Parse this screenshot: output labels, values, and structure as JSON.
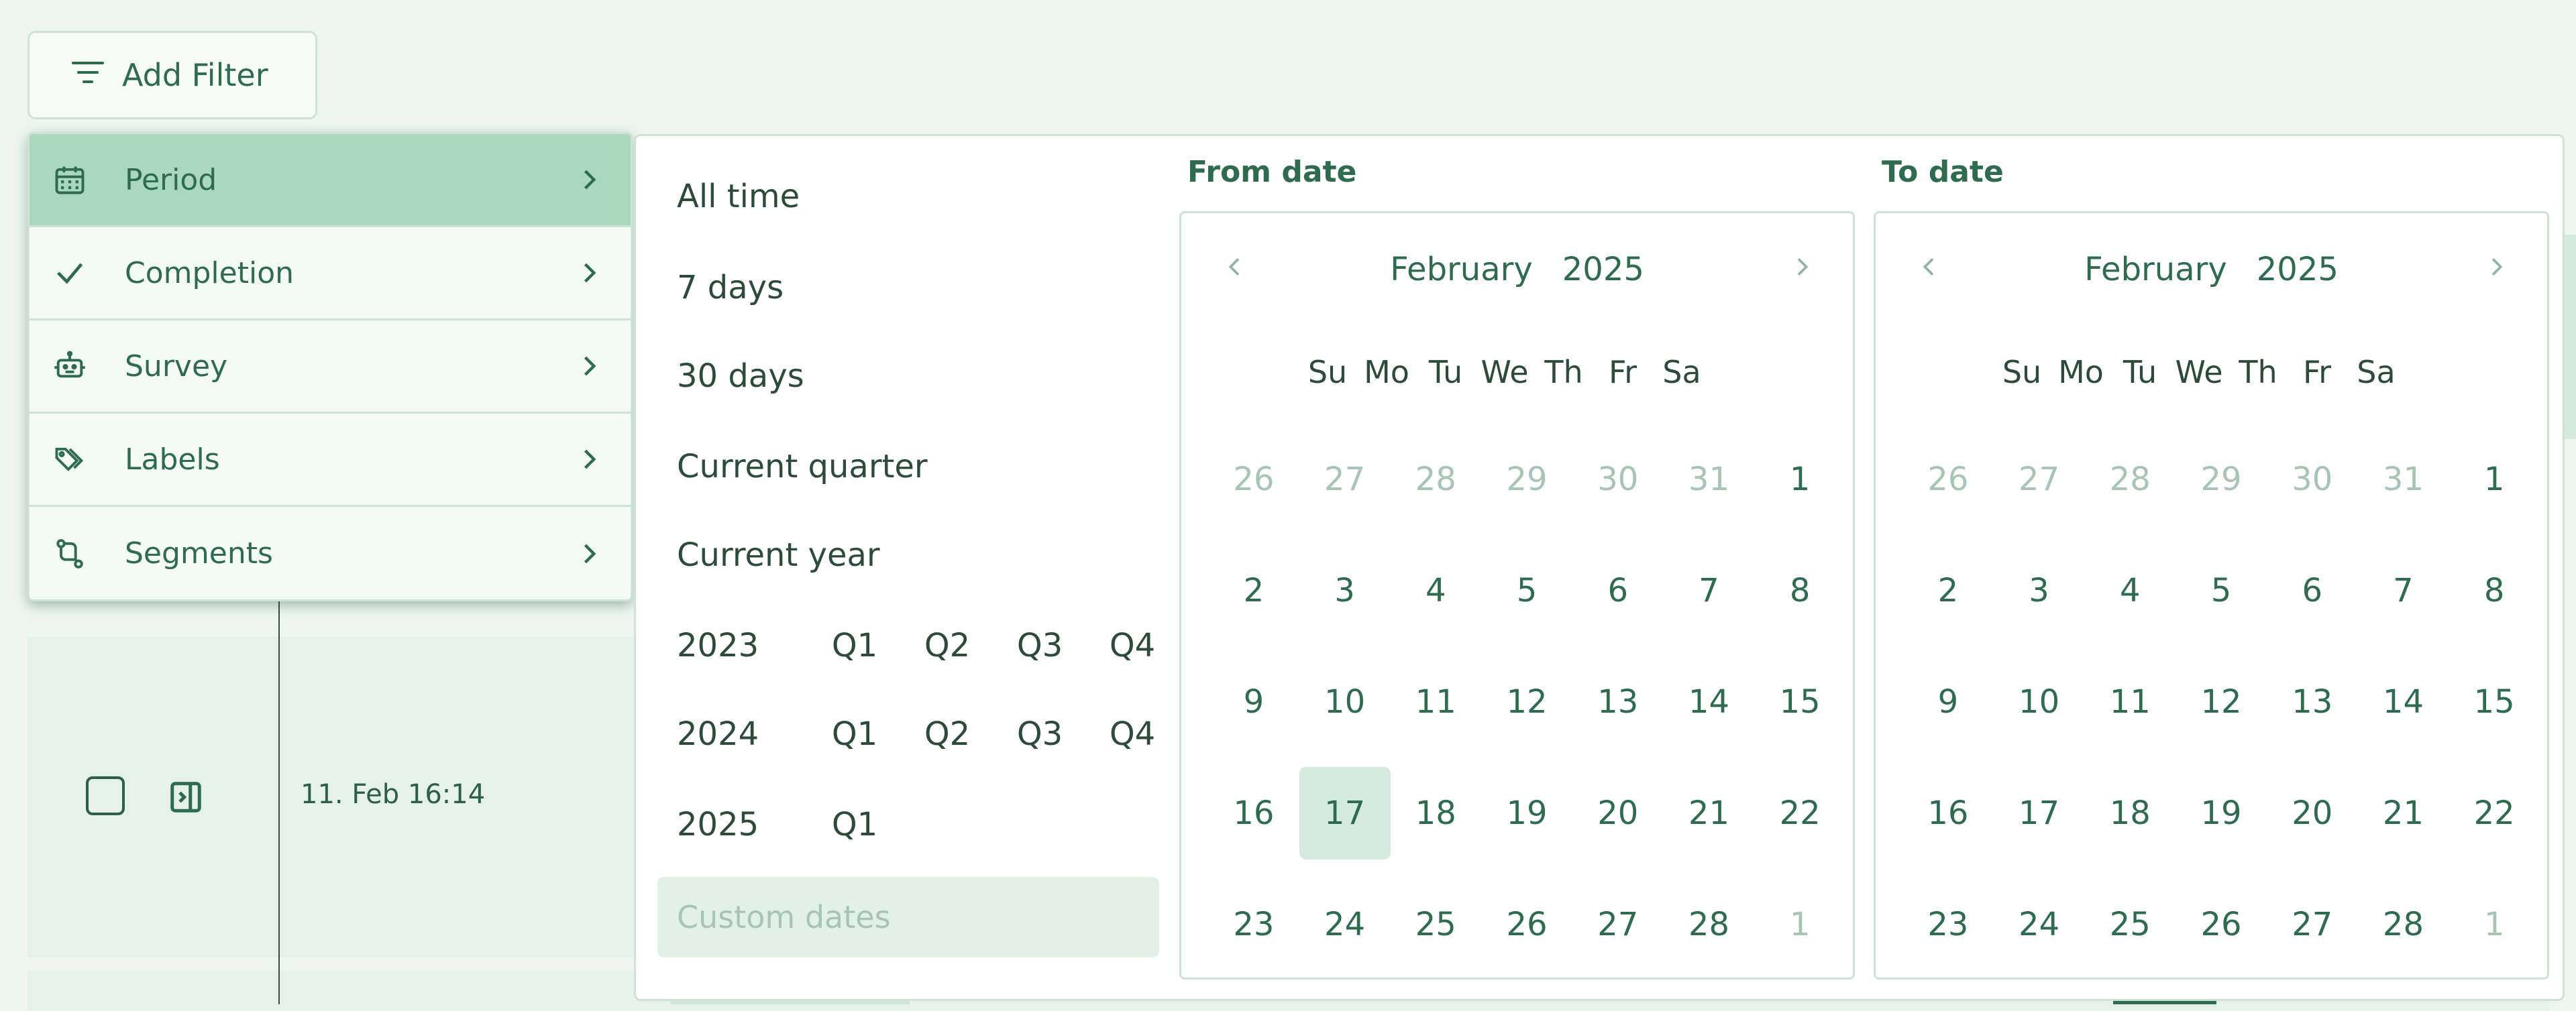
{
  "add_filter": {
    "label": "Add Filter",
    "icon": "filter-icon"
  },
  "filter_menu": {
    "items": [
      {
        "label": "Period",
        "icon": "calendar-icon",
        "active": true
      },
      {
        "label": "Completion",
        "icon": "check-icon",
        "active": false
      },
      {
        "label": "Survey",
        "icon": "robot-icon",
        "active": false
      },
      {
        "label": "Labels",
        "icon": "tags-icon",
        "active": false
      },
      {
        "label": "Segments",
        "icon": "route-icon",
        "active": false
      }
    ]
  },
  "period_options": {
    "all_time": "All time",
    "days7": "7 days",
    "days30": "30 days",
    "current_quarter": "Current quarter",
    "current_year": "Current year",
    "years": [
      {
        "year": "2023",
        "quarters": [
          "Q1",
          "Q2",
          "Q3",
          "Q4"
        ]
      },
      {
        "year": "2024",
        "quarters": [
          "Q1",
          "Q2",
          "Q3",
          "Q4"
        ]
      },
      {
        "year": "2025",
        "quarters": [
          "Q1"
        ]
      }
    ],
    "custom_dates": "Custom dates"
  },
  "from_date": {
    "header": "From date",
    "month": "February",
    "year": "2025",
    "weekdays": [
      "Su",
      "Mo",
      "Tu",
      "We",
      "Th",
      "Fr",
      "Sa"
    ],
    "weeks": [
      [
        "26",
        "27",
        "28",
        "29",
        "30",
        "31",
        "1"
      ],
      [
        "2",
        "3",
        "4",
        "5",
        "6",
        "7",
        "8"
      ],
      [
        "9",
        "10",
        "11",
        "12",
        "13",
        "14",
        "15"
      ],
      [
        "16",
        "17",
        "18",
        "19",
        "20",
        "21",
        "22"
      ],
      [
        "23",
        "24",
        "25",
        "26",
        "27",
        "28",
        "1"
      ]
    ],
    "today": "17"
  },
  "to_date": {
    "header": "To date",
    "month": "February",
    "year": "2025",
    "weekdays": [
      "Su",
      "Mo",
      "Tu",
      "We",
      "Th",
      "Fr",
      "Sa"
    ],
    "weeks": [
      [
        "26",
        "27",
        "28",
        "29",
        "30",
        "31",
        "1"
      ],
      [
        "2",
        "3",
        "4",
        "5",
        "6",
        "7",
        "8"
      ],
      [
        "9",
        "10",
        "11",
        "12",
        "13",
        "14",
        "15"
      ],
      [
        "16",
        "17",
        "18",
        "19",
        "20",
        "21",
        "22"
      ],
      [
        "23",
        "24",
        "25",
        "26",
        "27",
        "28",
        "1"
      ]
    ]
  },
  "background_row": {
    "date": "11. Feb 16:14"
  },
  "colors": {
    "accent": "#2f6b4f",
    "active_bg": "#a9d8bd",
    "muted": "#a7c4b4",
    "page_bg": "#eef6f1"
  }
}
